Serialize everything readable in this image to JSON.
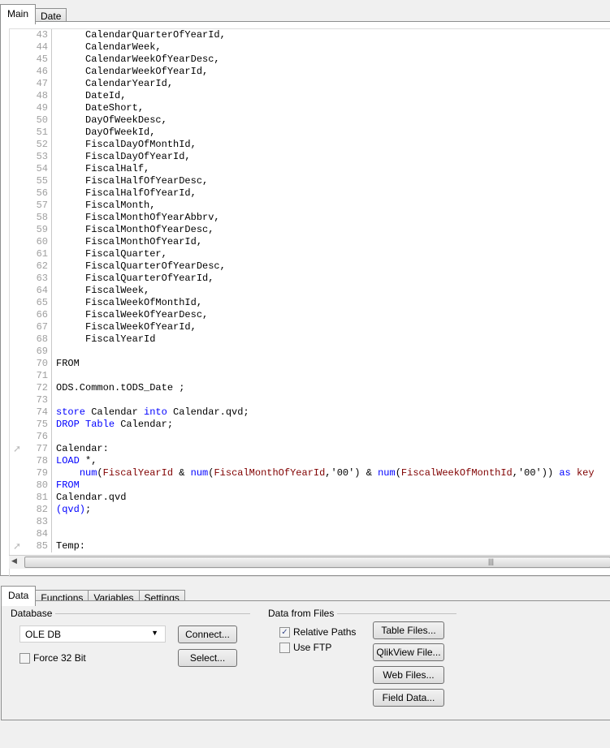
{
  "editor_tabs": [
    "Main",
    "Date"
  ],
  "code_lines": [
    {
      "n": "43",
      "t": [
        [
          "     CalendarQuarterOfYearId,",
          "tx"
        ]
      ]
    },
    {
      "n": "44",
      "t": [
        [
          "     CalendarWeek,",
          "tx"
        ]
      ]
    },
    {
      "n": "45",
      "t": [
        [
          "     CalendarWeekOfYearDesc,",
          "tx"
        ]
      ]
    },
    {
      "n": "46",
      "t": [
        [
          "     CalendarWeekOfYearId,",
          "tx"
        ]
      ]
    },
    {
      "n": "47",
      "t": [
        [
          "     CalendarYearId,",
          "tx"
        ]
      ]
    },
    {
      "n": "48",
      "t": [
        [
          "     DateId,",
          "tx"
        ]
      ]
    },
    {
      "n": "49",
      "t": [
        [
          "     DateShort,",
          "tx"
        ]
      ]
    },
    {
      "n": "50",
      "t": [
        [
          "     DayOfWeekDesc,",
          "tx"
        ]
      ]
    },
    {
      "n": "51",
      "t": [
        [
          "     DayOfWeekId,",
          "tx"
        ]
      ]
    },
    {
      "n": "52",
      "t": [
        [
          "     FiscalDayOfMonthId,",
          "tx"
        ]
      ]
    },
    {
      "n": "53",
      "t": [
        [
          "     FiscalDayOfYearId,",
          "tx"
        ]
      ]
    },
    {
      "n": "54",
      "t": [
        [
          "     FiscalHalf,",
          "tx"
        ]
      ]
    },
    {
      "n": "55",
      "t": [
        [
          "     FiscalHalfOfYearDesc,",
          "tx"
        ]
      ]
    },
    {
      "n": "56",
      "t": [
        [
          "     FiscalHalfOfYearId,",
          "tx"
        ]
      ]
    },
    {
      "n": "57",
      "t": [
        [
          "     FiscalMonth,",
          "tx"
        ]
      ]
    },
    {
      "n": "58",
      "t": [
        [
          "     FiscalMonthOfYearAbbrv,",
          "tx"
        ]
      ]
    },
    {
      "n": "59",
      "t": [
        [
          "     FiscalMonthOfYearDesc,",
          "tx"
        ]
      ]
    },
    {
      "n": "60",
      "t": [
        [
          "     FiscalMonthOfYearId,",
          "tx"
        ]
      ]
    },
    {
      "n": "61",
      "t": [
        [
          "     FiscalQuarter,",
          "tx"
        ]
      ]
    },
    {
      "n": "62",
      "t": [
        [
          "     FiscalQuarterOfYearDesc,",
          "tx"
        ]
      ]
    },
    {
      "n": "63",
      "t": [
        [
          "     FiscalQuarterOfYearId,",
          "tx"
        ]
      ]
    },
    {
      "n": "64",
      "t": [
        [
          "     FiscalWeek,",
          "tx"
        ]
      ]
    },
    {
      "n": "65",
      "t": [
        [
          "     FiscalWeekOfMonthId,",
          "tx"
        ]
      ]
    },
    {
      "n": "66",
      "t": [
        [
          "     FiscalWeekOfYearDesc,",
          "tx"
        ]
      ]
    },
    {
      "n": "67",
      "t": [
        [
          "     FiscalWeekOfYearId,",
          "tx"
        ]
      ]
    },
    {
      "n": "68",
      "t": [
        [
          "     FiscalYearId",
          "tx"
        ]
      ]
    },
    {
      "n": "69",
      "t": []
    },
    {
      "n": "70",
      "t": [
        [
          "FROM",
          "tx"
        ]
      ]
    },
    {
      "n": "71",
      "t": []
    },
    {
      "n": "72",
      "t": [
        [
          "ODS.Common.tODS_Date ;",
          "tx"
        ]
      ]
    },
    {
      "n": "73",
      "t": []
    },
    {
      "n": "74",
      "t": [
        [
          "store",
          "kw"
        ],
        [
          " Calendar ",
          "tx"
        ],
        [
          "into",
          "kw"
        ],
        [
          " Calendar.qvd;",
          "tx"
        ]
      ]
    },
    {
      "n": "75",
      "t": [
        [
          "DROP",
          "kw"
        ],
        [
          " ",
          "tx"
        ],
        [
          "Table",
          "kw"
        ],
        [
          " Calendar;",
          "tx"
        ]
      ]
    },
    {
      "n": "76",
      "t": []
    },
    {
      "n": "77",
      "bookmark": true,
      "t": [
        [
          "Calendar:",
          "tx"
        ]
      ]
    },
    {
      "n": "78",
      "t": [
        [
          "LOAD",
          "kw"
        ],
        [
          " *,",
          "tx"
        ]
      ]
    },
    {
      "n": "79",
      "t": [
        [
          "    ",
          "tx"
        ],
        [
          "num",
          "kw"
        ],
        [
          "(",
          "tx"
        ],
        [
          "FiscalYearId",
          "fld"
        ],
        [
          " & ",
          "tx"
        ],
        [
          "num",
          "kw"
        ],
        [
          "(",
          "tx"
        ],
        [
          "FiscalMonthOfYearId",
          "fld"
        ],
        [
          ",'00') & ",
          "tx"
        ],
        [
          "num",
          "kw"
        ],
        [
          "(",
          "tx"
        ],
        [
          "FiscalWeekOfMonthId",
          "fld"
        ],
        [
          ",'00')) ",
          "tx"
        ],
        [
          "as",
          "kw"
        ],
        [
          " ",
          "tx"
        ],
        [
          "key",
          "fld"
        ]
      ]
    },
    {
      "n": "80",
      "t": [
        [
          "FROM",
          "kw"
        ]
      ]
    },
    {
      "n": "81",
      "t": [
        [
          "Calendar.qvd",
          "tx"
        ]
      ]
    },
    {
      "n": "82",
      "t": [
        [
          "(qvd)",
          "kw"
        ],
        [
          ";",
          "tx"
        ]
      ]
    },
    {
      "n": "83",
      "t": []
    },
    {
      "n": "84",
      "t": []
    },
    {
      "n": "85",
      "bookmark": true,
      "t": [
        [
          "Temp:",
          "tx"
        ]
      ]
    }
  ],
  "bottom_tabs": [
    "Data",
    "Functions",
    "Variables",
    "Settings"
  ],
  "database": {
    "label": "Database",
    "selected": "OLE DB",
    "connect": "Connect...",
    "select": "Select...",
    "force32": "Force 32 Bit",
    "force32_checked": false
  },
  "files": {
    "label": "Data from Files",
    "relative_paths": "Relative Paths",
    "relative_checked": true,
    "use_ftp": "Use FTP",
    "ftp_checked": false,
    "buttons": [
      "Table Files...",
      "QlikView File...",
      "Web Files...",
      "Field Data..."
    ]
  },
  "colors": {
    "keyword": "#0000ff",
    "field": "#800000"
  }
}
